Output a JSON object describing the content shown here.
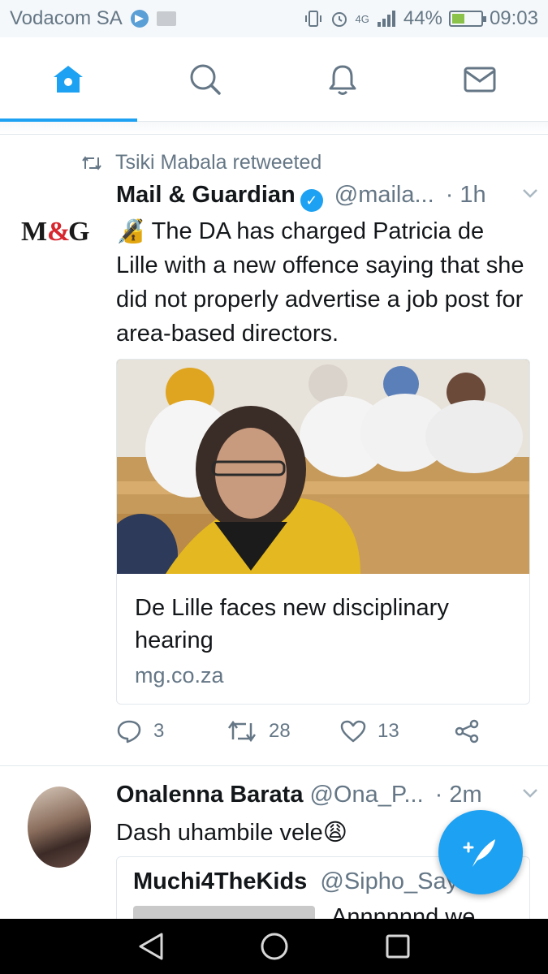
{
  "status_bar": {
    "carrier": "Vodacom SA",
    "network": "4G",
    "battery_percent": "44%",
    "battery_level": 0.44,
    "time": "09:03"
  },
  "nav": {
    "tabs": [
      {
        "icon": "home-icon",
        "active": true
      },
      {
        "icon": "search-icon",
        "active": false
      },
      {
        "icon": "notifications-icon",
        "active": false
      },
      {
        "icon": "messages-icon",
        "active": false
      }
    ]
  },
  "tweets": [
    {
      "retweeted_by": "Tsiki Mabala retweeted",
      "avatar_text": "M&G",
      "name": "Mail & Guardian",
      "verified": true,
      "handle": "@maila...",
      "time": "· 1h",
      "text": "🔏 The DA has charged Patricia de Lille with a new offence saying that she did not properly advertise a job post for area-based directors.",
      "card": {
        "title": "De Lille faces new disciplinary hearing",
        "domain": "mg.co.za"
      },
      "stats": {
        "replies": "3",
        "retweets": "28",
        "likes": "13"
      }
    },
    {
      "name": "Onalenna Barata",
      "handle": "@Ona_P...",
      "time": "· 2m",
      "text": "Dash uhambile vele😩",
      "quote": {
        "name": "Muchi4TheKids",
        "handle": "@Sipho_Say",
        "text": "Annnnnnd we"
      }
    }
  ],
  "colors": {
    "accent": "#1da1f2",
    "text_primary": "#14171a",
    "text_secondary": "#657786",
    "border": "#e1e8ed"
  }
}
